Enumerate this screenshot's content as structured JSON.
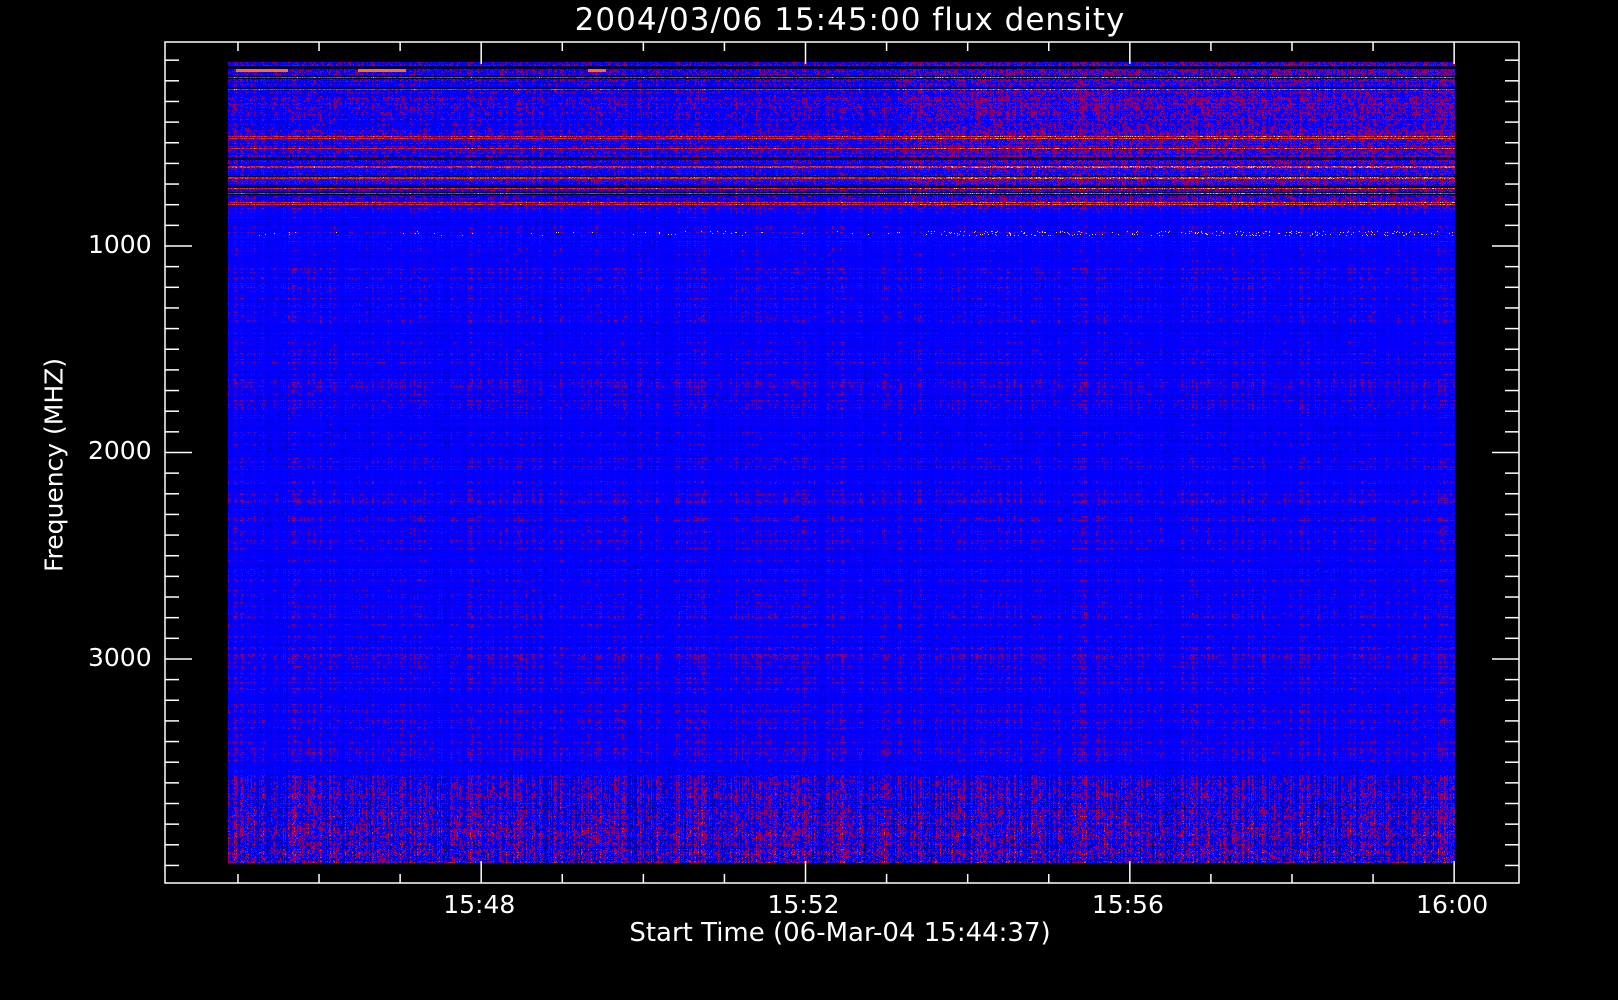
{
  "chart_data": {
    "type": "heatmap",
    "title": "2004/03/06 15:45:00 flux density",
    "xlabel": "Start Time (06-Mar-04 15:44:37)",
    "ylabel": "Frequency (MHZ)",
    "x_ticks": [
      {
        "label": "15:48",
        "minutes": 228
      },
      {
        "label": "15:52",
        "minutes": 232
      },
      {
        "label": "15:56",
        "minutes": 236
      },
      {
        "label": "16:00",
        "minutes": 240
      }
    ],
    "x_minor_step_minutes": 1,
    "xlim_minutes": [
      224.1,
      240.8
    ],
    "data_x_range_minutes": [
      224.8,
      240.0
    ],
    "y_ticks": [
      {
        "label": "1000",
        "value": 1000
      },
      {
        "label": "2000",
        "value": 2000
      },
      {
        "label": "3000",
        "value": 3000
      }
    ],
    "y_minor_step": 100,
    "ylim": [
      12,
      4085
    ],
    "y_inverted": true,
    "data_y_range": [
      100,
      3980
    ],
    "colormap": [
      "#000000",
      "#0000ff",
      "#c00000",
      "#ff6020",
      "#ffff80",
      "#ffffff"
    ],
    "features": {
      "rfi_bands_mhz": [
        120,
        170,
        220,
        460,
        510,
        560,
        600,
        650,
        700,
        730,
        780
      ],
      "bursty_band_mhz": 930,
      "lower_noise_band_mhz": [
        3550,
        3980
      ]
    }
  }
}
